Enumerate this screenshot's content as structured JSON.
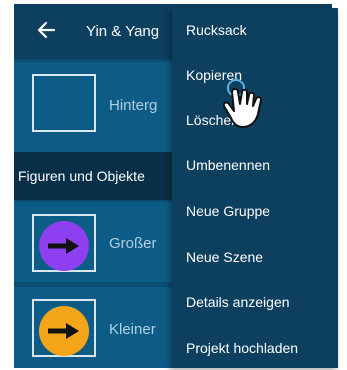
{
  "header": {
    "title": "Yin & Yang"
  },
  "rows": {
    "background_label": "Hinterg",
    "big_label": "Großer",
    "small_label": "Kleiner"
  },
  "section": {
    "label": "Figuren und Objekte"
  },
  "menu": {
    "items": [
      {
        "label": "Rucksack"
      },
      {
        "label": "Kopieren"
      },
      {
        "label": "Löschen"
      },
      {
        "label": "Umbenennen"
      },
      {
        "label": "Neue Gruppe"
      },
      {
        "label": "Neue Szene"
      },
      {
        "label": "Details anzeigen"
      },
      {
        "label": "Projekt hochladen"
      }
    ]
  },
  "colors": {
    "purple_circle": "#8e3ff0",
    "orange_circle": "#f5a51a"
  },
  "icons": [
    "back-arrow-icon",
    "arrow-right-icon",
    "tap-hand-icon"
  ]
}
